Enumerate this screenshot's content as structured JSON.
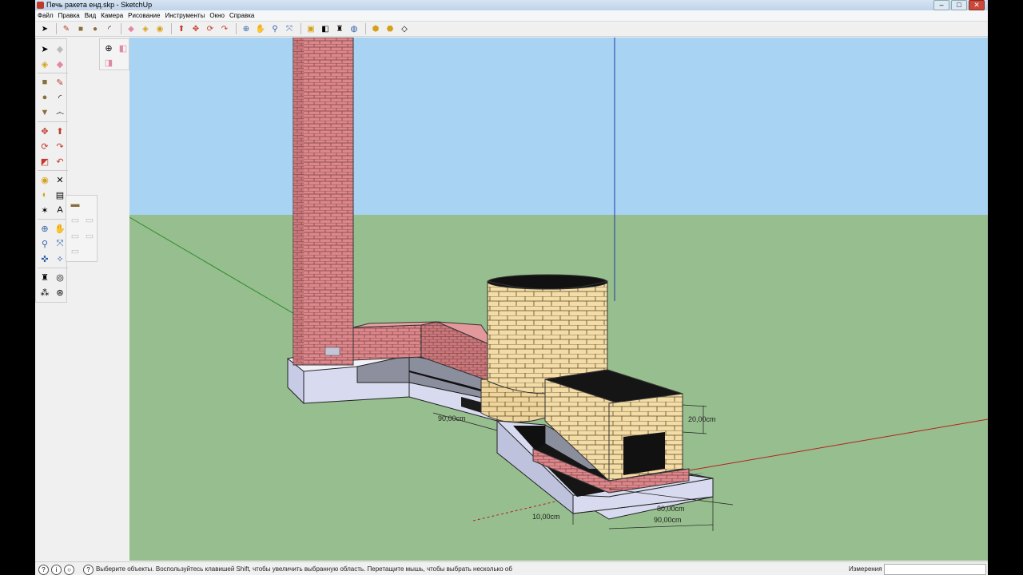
{
  "window": {
    "title": "Печь ракета енд.skp - SketchUp",
    "buttons": {
      "minimize": "–",
      "maximize": "□",
      "close": "✕"
    }
  },
  "menubar": [
    "Файл",
    "Правка",
    "Вид",
    "Камера",
    "Рисование",
    "Инструменты",
    "Окно",
    "Справка"
  ],
  "toolbar": {
    "icons": [
      "select-icon",
      "pencil-icon",
      "rectangle-icon",
      "circle-icon",
      "arc-icon",
      "eraser-icon",
      "paint-icon",
      "tape-measure-icon",
      "push-pull-icon",
      "move-icon",
      "rotate-icon",
      "follow-me-icon",
      "orbit-icon",
      "pan-icon",
      "zoom-icon",
      "zoom-extents-icon",
      "component-icon",
      "section-icon",
      "position-camera-icon",
      "walk-icon",
      "look-around-icon",
      "3d-warehouse-icon",
      "share-model-icon",
      "get-models-icon"
    ]
  },
  "dimensions": {
    "d20": "20,00cm",
    "d90_side": "90,00cm",
    "d80": "80,00cm",
    "d90_front": "90,00cm",
    "d10": "10,00cm"
  },
  "statusbar": {
    "hint": "Выберите объекты. Воспользуйтесь клавишей Shift, чтобы увеличить выбранную область. Перетащите мышь, чтобы выбрать несколько об",
    "measurements_label": "Измерения",
    "measurements_value": ""
  },
  "colors": {
    "sky": "#a9d3f2",
    "ground": "#97be8e",
    "brick_red": "#d9868a",
    "brick_yellow": "#f3dca6",
    "concrete": "#d8dbef"
  }
}
